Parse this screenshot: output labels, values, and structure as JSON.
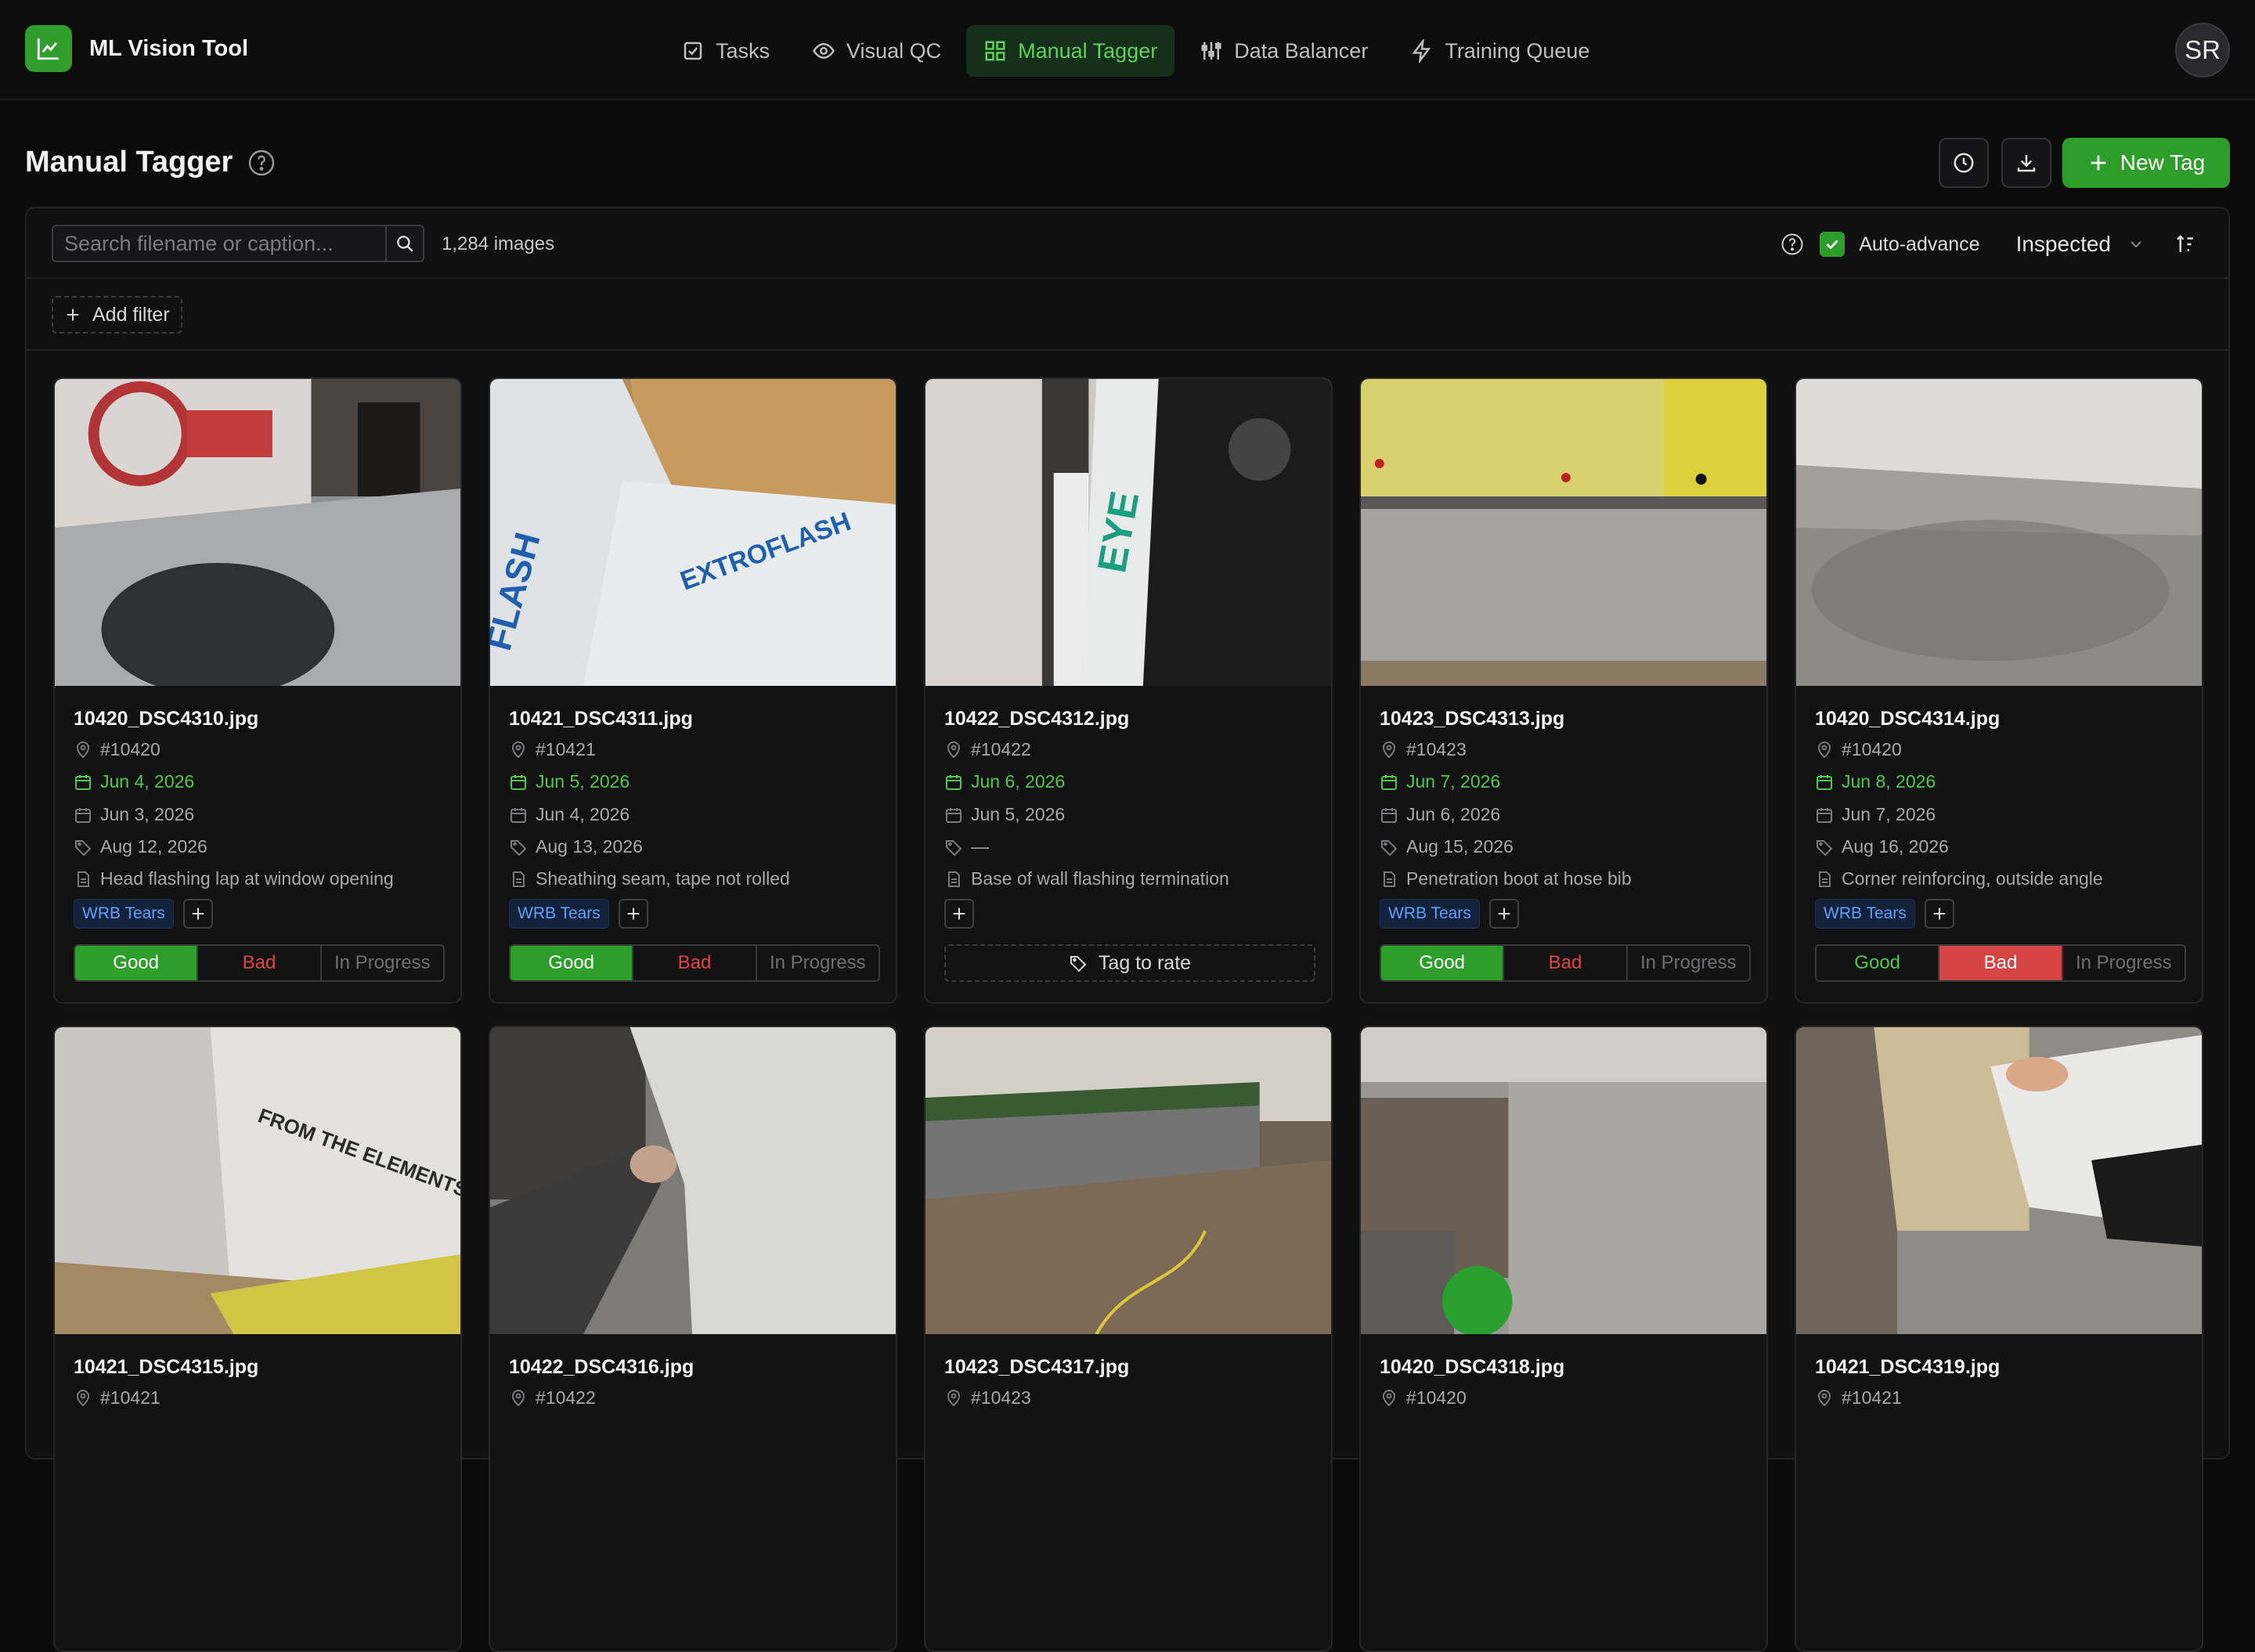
{
  "app": {
    "name": "ML Vision Tool",
    "avatar_initials": "SR"
  },
  "nav": [
    {
      "label": "Tasks",
      "icon": "checkbox-icon",
      "active": false
    },
    {
      "label": "Visual QC",
      "icon": "eye-icon",
      "active": false
    },
    {
      "label": "Manual Tagger",
      "icon": "grid-icon",
      "active": true
    },
    {
      "label": "Data Balancer",
      "icon": "sliders-icon",
      "active": false
    },
    {
      "label": "Training Queue",
      "icon": "bolt-icon",
      "active": false
    }
  ],
  "header": {
    "title": "Manual Tagger",
    "new_tag_label": "New Tag"
  },
  "toolbar": {
    "search_placeholder": "Search filename or caption...",
    "image_count": "1,284 images",
    "auto_advance_label": "Auto-advance",
    "auto_advance_checked": true,
    "status_select": "Inspected",
    "add_filter_label": "Add filter"
  },
  "rating_labels": {
    "good": "Good",
    "bad": "Bad",
    "progress": "In Progress",
    "tag_to_rate": "Tag to rate"
  },
  "cards": [
    {
      "filename": "10420_DSC4310.jpg",
      "job": "#10420",
      "date_green": "Jun 4, 2026",
      "date2": "Jun 3, 2026",
      "date3": "Aug 12, 2026",
      "caption": "Head flashing lap at window opening",
      "tags": [
        "WRB Tears"
      ],
      "rating": "good"
    },
    {
      "filename": "10421_DSC4311.jpg",
      "job": "#10421",
      "date_green": "Jun 5, 2026",
      "date2": "Jun 4, 2026",
      "date3": "Aug 13, 2026",
      "caption": "Sheathing seam, tape not rolled",
      "tags": [
        "WRB Tears"
      ],
      "rating": "good"
    },
    {
      "filename": "10422_DSC4312.jpg",
      "job": "#10422",
      "date_green": "Jun 6, 2026",
      "date2": "Jun 5, 2026",
      "date3": "—",
      "caption": "Base of wall flashing termination",
      "tags": [],
      "rating": "none"
    },
    {
      "filename": "10423_DSC4313.jpg",
      "job": "#10423",
      "date_green": "Jun 7, 2026",
      "date2": "Jun 6, 2026",
      "date3": "Aug 15, 2026",
      "caption": "Penetration boot at hose bib",
      "tags": [
        "WRB Tears"
      ],
      "rating": "good"
    },
    {
      "filename": "10420_DSC4314.jpg",
      "job": "#10420",
      "date_green": "Jun 8, 2026",
      "date2": "Jun 7, 2026",
      "date3": "Aug 16, 2026",
      "caption": "Corner reinforcing, outside angle",
      "tags": [
        "WRB Tears"
      ],
      "rating": "bad"
    },
    {
      "filename": "10421_DSC4315.jpg",
      "job": "#10421"
    },
    {
      "filename": "10422_DSC4316.jpg",
      "job": "#10422"
    },
    {
      "filename": "10423_DSC4317.jpg",
      "job": "#10423"
    },
    {
      "filename": "10420_DSC4318.jpg",
      "job": "#10420"
    },
    {
      "filename": "10421_DSC4319.jpg",
      "job": "#10421"
    }
  ],
  "colors": {
    "accent": "#2e9e2b",
    "bad": "#d64343",
    "tag": "#5ea0ff"
  }
}
